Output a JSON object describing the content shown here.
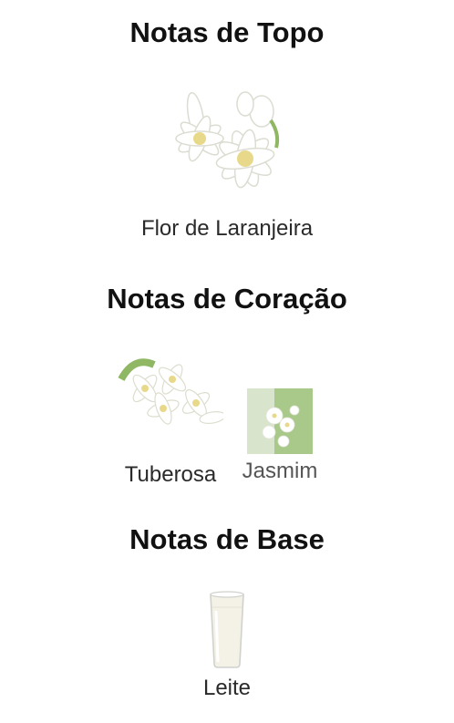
{
  "sections": {
    "top": {
      "title": "Notas de Topo",
      "notes": [
        {
          "label": "Flor de Laranjeira",
          "icon": "orange-blossom-image"
        }
      ]
    },
    "heart": {
      "title": "Notas de Coração",
      "notes": [
        {
          "label": "Tuberosa",
          "icon": "tuberose-image"
        },
        {
          "label": "Jasmim",
          "icon": "jasmine-image"
        }
      ]
    },
    "base": {
      "title": "Notas de Base",
      "notes": [
        {
          "label": "Leite",
          "icon": "milk-glass-image"
        }
      ]
    }
  },
  "colors": {
    "petal": "#ffffff",
    "petal_shadow": "#e3e3dc",
    "flower_center": "#e8d98a",
    "leaf": "#8fb764",
    "milk": "#f4f1e6",
    "glass": "#d9dcd8"
  }
}
